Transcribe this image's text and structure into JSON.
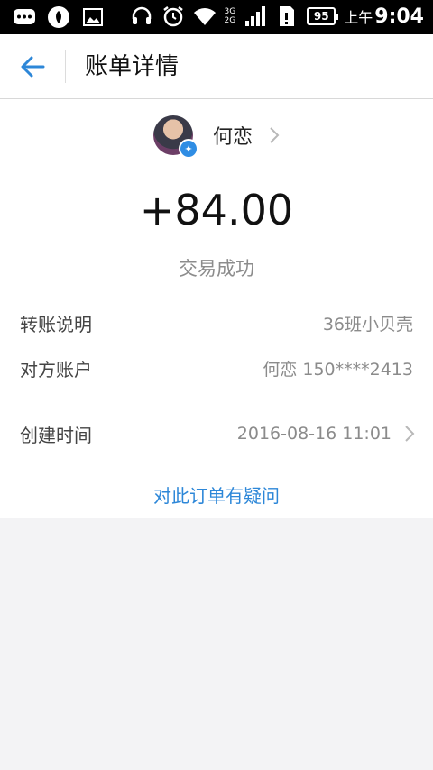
{
  "status_bar": {
    "network_top": "3G",
    "network_bottom": "2G",
    "battery_level": "95",
    "time_ampm": "上午",
    "time": "9:04"
  },
  "header": {
    "title": "账单详情"
  },
  "payee": {
    "name": "何恋"
  },
  "transaction": {
    "amount": "+84.00",
    "status": "交易成功"
  },
  "details": [
    {
      "label": "转账说明",
      "value": "36班小贝壳"
    },
    {
      "label": "对方账户",
      "value": "何恋 150****2413"
    },
    {
      "label": "创建时间",
      "value": "2016-08-16 11:01"
    }
  ],
  "help_link": "对此订单有疑问",
  "colors": {
    "accent": "#2d87d8",
    "page_bg": "#f3f3f5"
  }
}
